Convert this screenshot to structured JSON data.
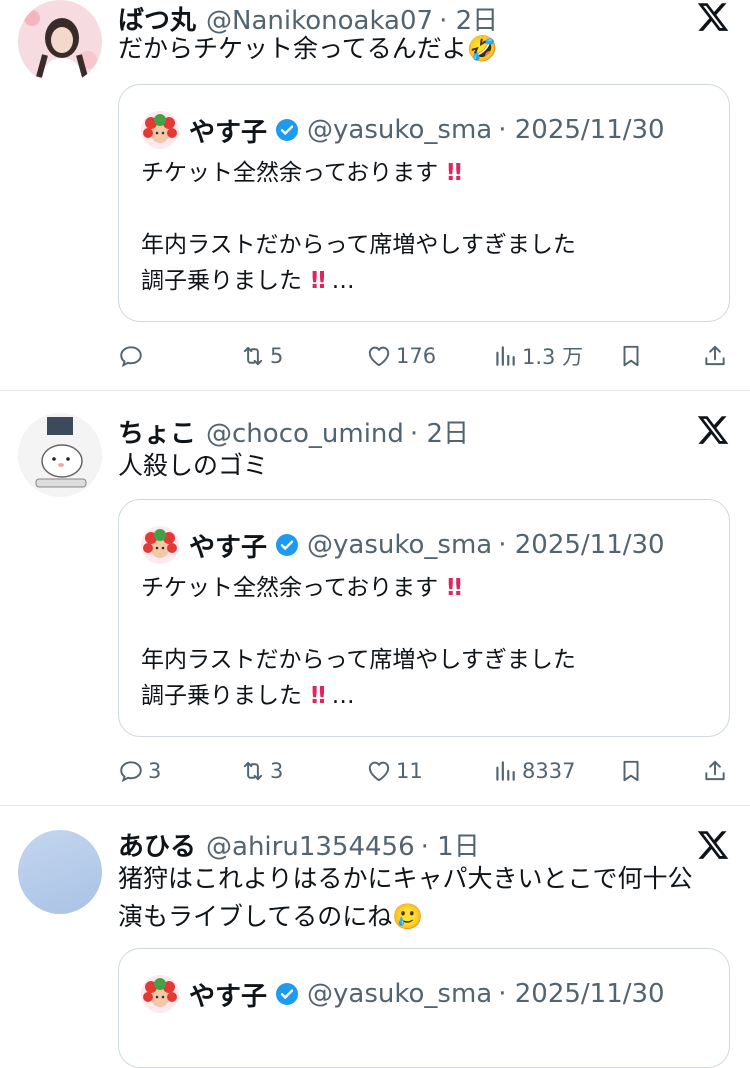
{
  "quoted": {
    "name": "やす子",
    "handle": "@yasuko_sma",
    "date": "· 2025/11/30",
    "line1": "チケット全然余っております",
    "line2": "年内ラストだからって席増やしすぎました",
    "line3": "調子乗りました",
    "ellipsis": "…"
  },
  "tweets": [
    {
      "name": "ばつ丸",
      "handle": "@Nanikonoaka07",
      "time": "· 2日",
      "text": "だからチケット余ってるんだよ",
      "text_emoji": "🤣",
      "replies": "",
      "retweets": "5",
      "likes": "176",
      "views": "1.3 万"
    },
    {
      "name": "ちょこ",
      "handle": "@choco_umind",
      "time": "· 2日",
      "text": "人殺しのゴミ",
      "replies": "3",
      "retweets": "3",
      "likes": "11",
      "views": "8337"
    },
    {
      "name": "あひる",
      "handle": "@ahiru1354456",
      "time": "· 1日",
      "text_line1": "猪狩はこれよりはるかにキャパ大きいとこで何十公",
      "text_line2": "演もライブしてるのにね",
      "text_emoji": "🥲"
    }
  ],
  "icons": [
    "x-logo-icon",
    "verified-badge-icon",
    "reply-icon",
    "retweet-icon",
    "like-icon",
    "views-icon",
    "bookmark-icon",
    "share-icon"
  ],
  "colors": {
    "accent": "#1d9bf0",
    "muted": "#536471",
    "bang": "#e0245e"
  }
}
